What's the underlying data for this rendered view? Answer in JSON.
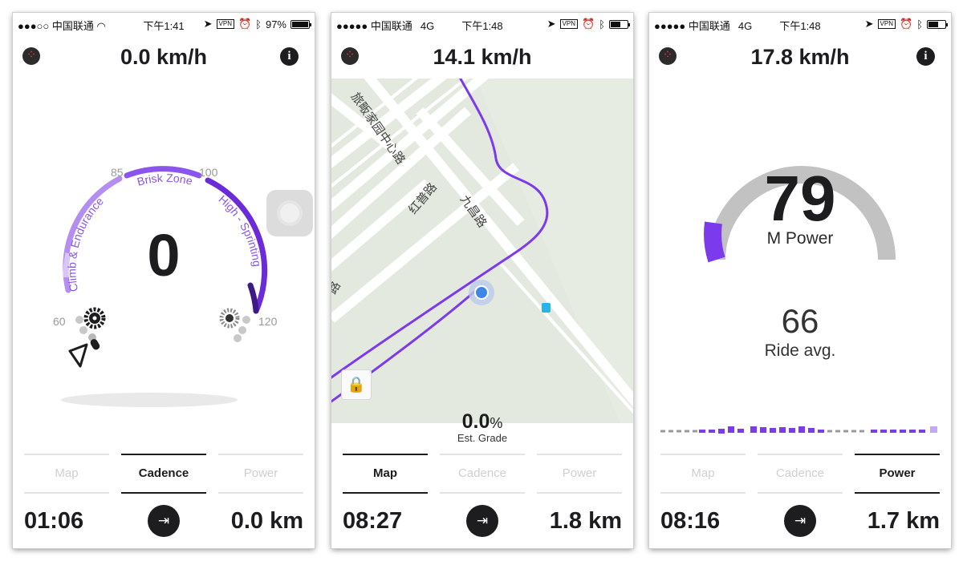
{
  "colors": {
    "accent": "#7c3aed",
    "accent_light": "#c4a7f5",
    "accent_mid": "#9b6bef",
    "gauge_track": "#bfbfbf",
    "dark": "#1d1d1f"
  },
  "screens": [
    {
      "status": {
        "carrier": "●●●○○ 中国联通",
        "network": "",
        "time": "下午1:41",
        "vpn": "VPN",
        "battery_pct": "97%"
      },
      "header": {
        "speed": "0.0 km/h",
        "logo_icon": "app-logo-icon",
        "info_icon": "info-icon"
      },
      "cadence": {
        "value": "0",
        "zones": [
          "Climb & Endurance",
          "Brisk Zone",
          "High - Sprinting"
        ],
        "ticks": [
          "60",
          "85",
          "100",
          "120"
        ]
      },
      "tabs": [
        "Map",
        "Cadence",
        "Power"
      ],
      "active_tab": 1,
      "footer": {
        "time": "01:06",
        "distance": "0.0 km",
        "exit_icon": "exit-icon"
      }
    },
    {
      "status": {
        "carrier": "●●●●● 中国联通",
        "network": "4G",
        "time": "下午1:48",
        "vpn": "VPN",
        "battery_pct": ""
      },
      "header": {
        "speed": "14.1 km/h",
        "logo_icon": "app-logo-icon",
        "info_icon": ""
      },
      "map": {
        "street_labels": [
          "旅畈家园中心路",
          "红普路",
          "九昌路",
          "路"
        ],
        "lock_icon": "lock-icon"
      },
      "grade": {
        "value": "0.0",
        "unit": "%",
        "label": "Est. Grade"
      },
      "tabs": [
        "Map",
        "Cadence",
        "Power"
      ],
      "active_tab": 0,
      "footer": {
        "time": "08:27",
        "distance": "1.8 km",
        "exit_icon": "exit-icon"
      }
    },
    {
      "status": {
        "carrier": "●●●●● 中国联通",
        "network": "4G",
        "time": "下午1:48",
        "vpn": "VPN",
        "battery_pct": ""
      },
      "header": {
        "speed": "17.8 km/h",
        "logo_icon": "app-logo-icon",
        "info_icon": "info-icon"
      },
      "power": {
        "value": "79",
        "label": "M Power",
        "avg_value": "66",
        "avg_label": "Ride avg."
      },
      "tabs": [
        "Map",
        "Cadence",
        "Power"
      ],
      "active_tab": 2,
      "footer": {
        "time": "08:16",
        "distance": "1.7 km",
        "exit_icon": "exit-icon"
      }
    }
  ]
}
